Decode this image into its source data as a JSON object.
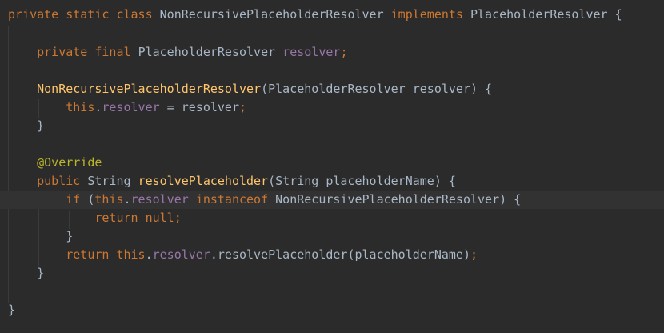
{
  "code": {
    "l1": {
      "a": "private static class ",
      "b": "NonRecursivePlaceholderResolver ",
      "c": "implements ",
      "d": "PlaceholderResolver {"
    },
    "l3": {
      "a": "private final ",
      "b": "PlaceholderResolver ",
      "c": "resolver",
      "d": ";"
    },
    "l5": {
      "a": "NonRecursivePlaceholderResolver",
      "b": "(PlaceholderResolver resolver) {"
    },
    "l6": {
      "a": "this",
      "b": ".",
      "c": "resolver",
      "d": " = resolver",
      "e": ";"
    },
    "l7": {
      "a": "}"
    },
    "l9": {
      "a": "@Override"
    },
    "l10": {
      "a": "public ",
      "b": "String ",
      "c": "resolvePlaceholder",
      "d": "(String placeholderName) {"
    },
    "l11": {
      "a": "if ",
      "b": "(",
      "c": "this",
      "d": ".",
      "e": "resolver ",
      "f": "instanceof ",
      "g": "NonRecursivePlaceholderResolver) {"
    },
    "l12": {
      "a": "return null",
      "b": ";"
    },
    "l13": {
      "a": "}"
    },
    "l14": {
      "a": "return this",
      "b": ".",
      "c": "resolver",
      "d": ".resolvePlaceholder(placeholderName)",
      "e": ";"
    },
    "l15": {
      "a": "}"
    },
    "l17": {
      "a": "}"
    }
  },
  "colors": {
    "background": "#2b2b2b",
    "current_line": "#323232",
    "keyword": "#cc7832",
    "method_declaration": "#ffc66d",
    "field": "#9876aa",
    "annotation": "#bbb529",
    "plain": "#a9b7c6"
  }
}
